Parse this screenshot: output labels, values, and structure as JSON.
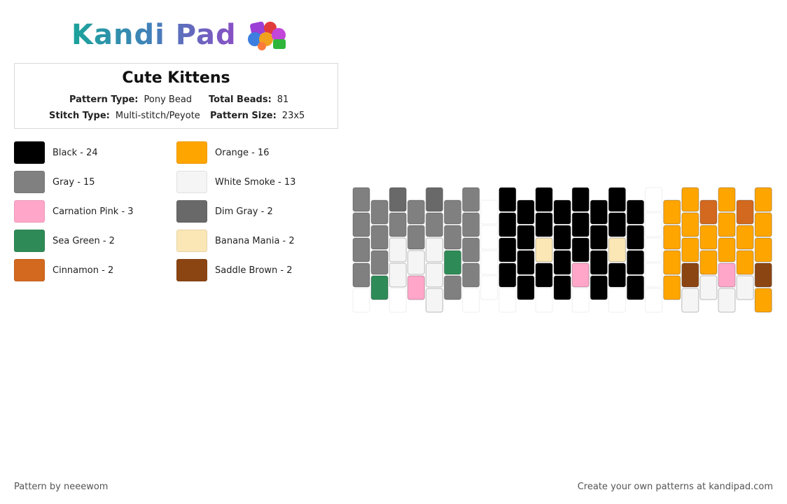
{
  "logo": {
    "text": "Kandi Pad",
    "icon": "candy-beads-icon"
  },
  "pattern_info": {
    "title": "Cute Kittens",
    "pattern_type_label": "Pattern Type:",
    "pattern_type": "Pony Bead",
    "total_beads_label": "Total Beads:",
    "total_beads": "81",
    "stitch_type_label": "Stitch Type:",
    "stitch_type": "Multi-stitch/Peyote",
    "pattern_size_label": "Pattern Size:",
    "pattern_size": "23x5"
  },
  "legend": [
    {
      "label": "Black - 24",
      "color": "#000000"
    },
    {
      "label": "Orange - 16",
      "color": "#ffa500"
    },
    {
      "label": "Gray - 15",
      "color": "#808080"
    },
    {
      "label": "White Smoke - 13",
      "color": "#f5f5f5"
    },
    {
      "label": "Carnation Pink - 3",
      "color": "#ffa6c9"
    },
    {
      "label": "Dim Gray - 2",
      "color": "#696969"
    },
    {
      "label": "Sea Green - 2",
      "color": "#2e8b57"
    },
    {
      "label": "Banana Mania - 2",
      "color": "#fae7b5"
    },
    {
      "label": "Cinnamon - 2",
      "color": "#d2691e"
    },
    {
      "label": "Saddle Brown - 2",
      "color": "#8b4513"
    }
  ],
  "bead_pattern": {
    "palette": {
      "B": "#000000",
      "O": "#ffa500",
      "G": "#808080",
      "W": "#f5f5f5",
      "P": "#ffa6c9",
      "D": "#696969",
      "S": "#2e8b57",
      "Y": "#fae7b5",
      "C": "#d2691e",
      "R": "#8b4513"
    },
    "columns": [
      "GGGG.",
      "GGGSW",
      "DGWW.",
      "GGWP.",
      "DGWWW",
      "GGSG.",
      "GGGG.",
      ".....",
      "BBBB.",
      "BBBBB",
      "BBYB.",
      "BBBBB",
      "BBBP.",
      "BBBBB",
      "BBYB.",
      "BBBB.",
      ".....",
      "OOOO.",
      "OOORW",
      "COOW.",
      "OOOPW",
      "COOW.",
      "OOOROW"
    ]
  },
  "footer": {
    "left": "Pattern by neeewom",
    "right": "Create your own patterns at kandipad.com"
  }
}
